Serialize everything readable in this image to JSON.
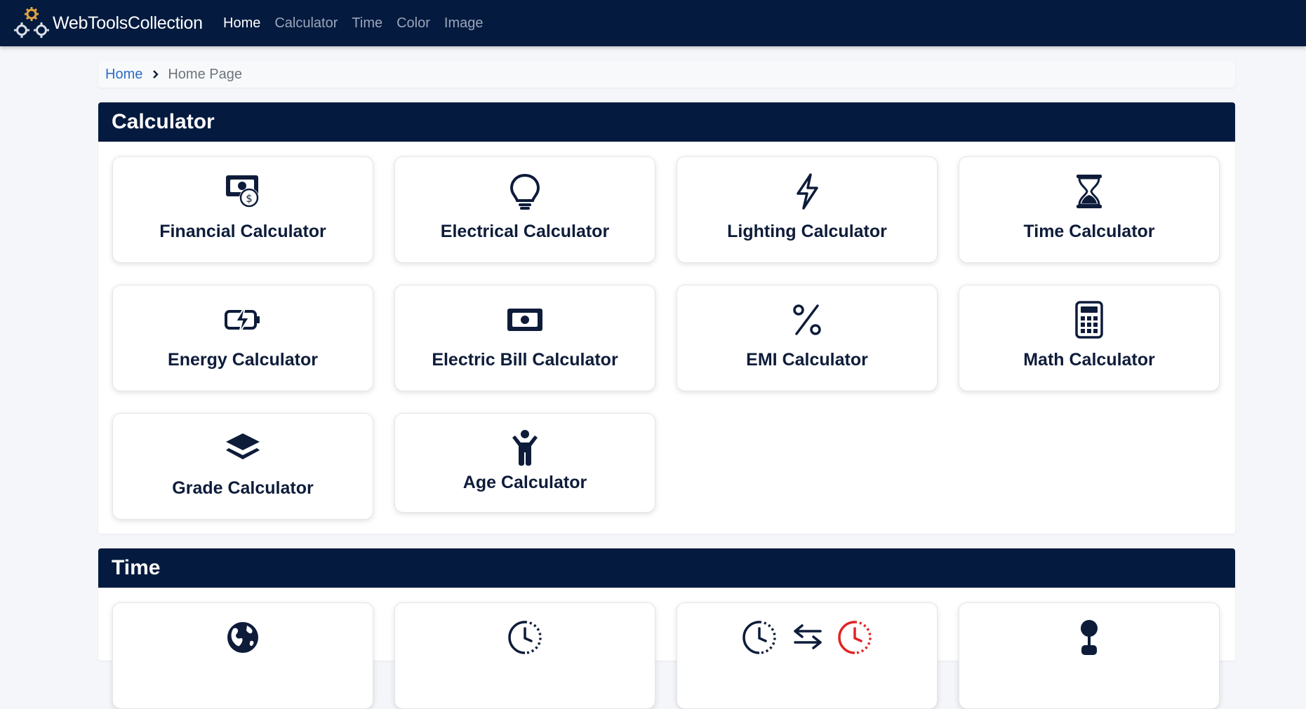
{
  "navbar": {
    "brand": "WebToolsCollection",
    "links": [
      {
        "label": "Home"
      },
      {
        "label": "Calculator"
      },
      {
        "label": "Time"
      },
      {
        "label": "Color"
      },
      {
        "label": "Image"
      }
    ]
  },
  "breadcrumb": {
    "home": "Home",
    "current": "Home Page"
  },
  "sections": {
    "calculator": {
      "title": "Calculator",
      "cards": [
        {
          "label": "Financial Calculator",
          "icon": "money-bill-dollar-icon"
        },
        {
          "label": "Electrical Calculator",
          "icon": "lightbulb-icon"
        },
        {
          "label": "Lighting Calculator",
          "icon": "bolt-icon"
        },
        {
          "label": "Time Calculator",
          "icon": "hourglass-icon"
        },
        {
          "label": "Energy Calculator",
          "icon": "battery-bolt-icon"
        },
        {
          "label": "Electric Bill Calculator",
          "icon": "money-bill-icon"
        },
        {
          "label": "EMI Calculator",
          "icon": "percent-icon"
        },
        {
          "label": "Math Calculator",
          "icon": "calculator-icon"
        },
        {
          "label": "Grade Calculator",
          "icon": "layers-icon"
        },
        {
          "label": "Age Calculator",
          "icon": "child-icon"
        }
      ]
    },
    "time": {
      "title": "Time",
      "cards": [
        {
          "label": "",
          "icon": "globe-icon"
        },
        {
          "label": "",
          "icon": "clock-icon"
        },
        {
          "label": "",
          "icon": "clock-convert-icon"
        },
        {
          "label": "",
          "icon": "person-icon"
        }
      ]
    }
  },
  "colors": {
    "navbar_bg": "#041a3f",
    "accent_link": "#2d6cc6",
    "icon": "#0e1c3a",
    "alert_red": "#e02424"
  }
}
